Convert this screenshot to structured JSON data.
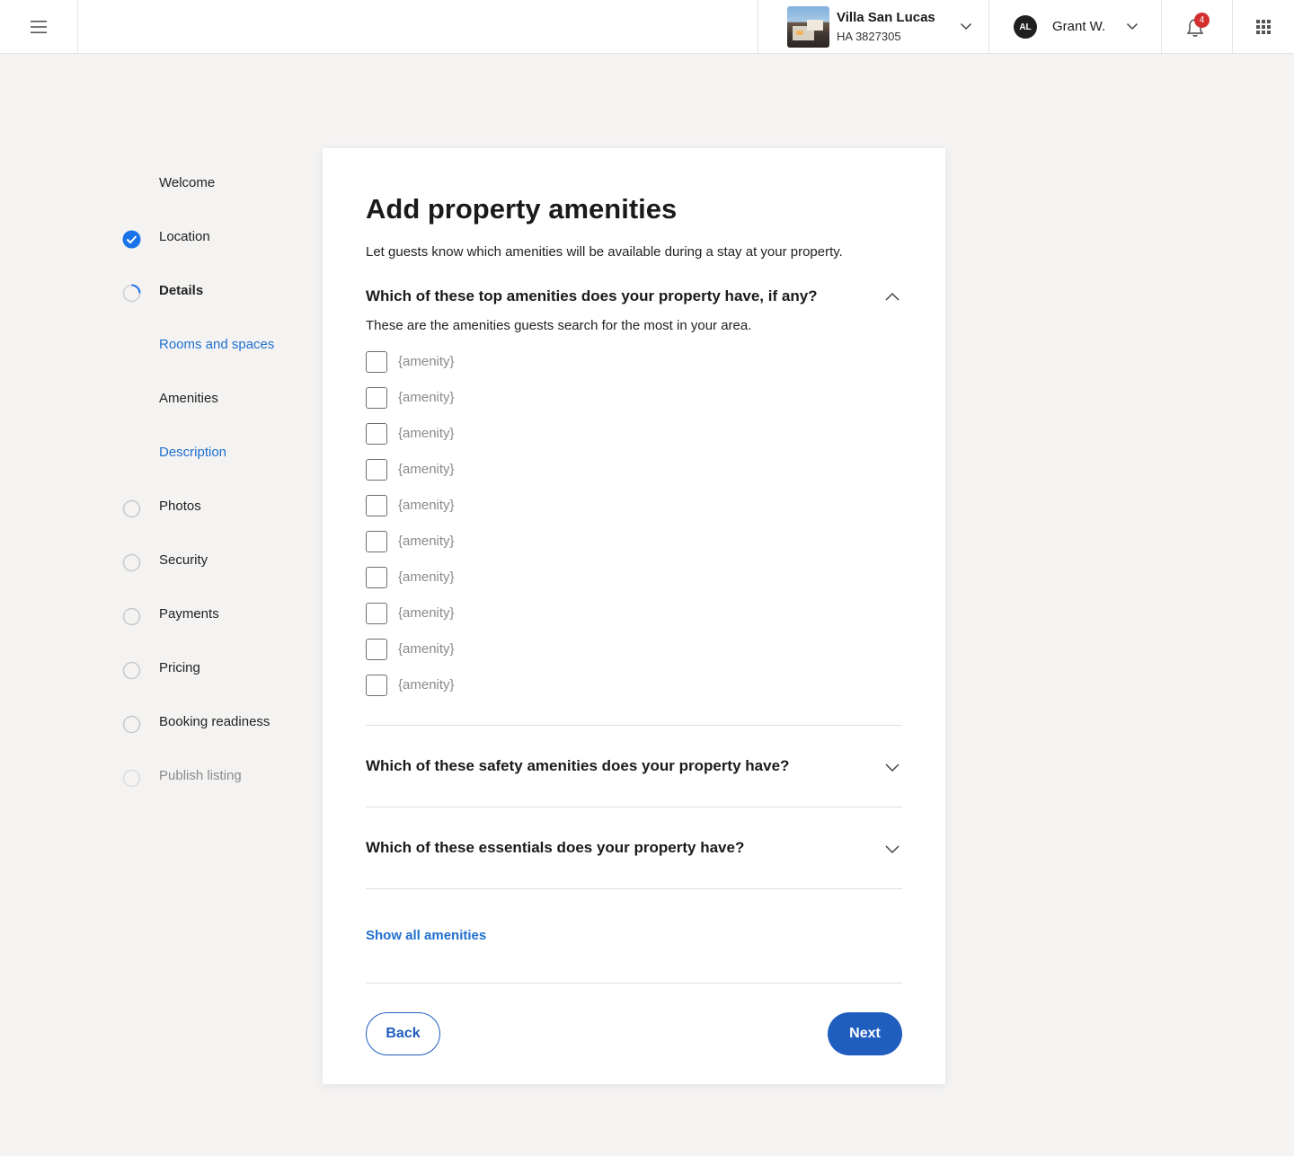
{
  "topbar": {
    "property": {
      "name": "Villa San Lucas",
      "id": "HA 3827305"
    },
    "user": {
      "initials": "AL",
      "name": "Grant W."
    },
    "notifications": {
      "count": "4"
    }
  },
  "steps": [
    {
      "label": "Welcome",
      "status": "none"
    },
    {
      "label": "Location",
      "status": "complete"
    },
    {
      "label": "Details",
      "status": "in-progress"
    },
    {
      "label": "Rooms and spaces",
      "status": "substep-link"
    },
    {
      "label": "Amenities",
      "status": "substep-current"
    },
    {
      "label": "Description",
      "status": "substep-link"
    },
    {
      "label": "Photos",
      "status": "incomplete"
    },
    {
      "label": "Security",
      "status": "incomplete"
    },
    {
      "label": "Payments",
      "status": "incomplete"
    },
    {
      "label": "Pricing",
      "status": "incomplete"
    },
    {
      "label": "Booking readiness",
      "status": "incomplete"
    },
    {
      "label": "Publish listing",
      "status": "disabled"
    }
  ],
  "main": {
    "title": "Add property amenities",
    "subtitle": "Let guests know which amenities will be available during a stay at your property.",
    "sections": [
      {
        "question": "Which of these top amenities does your property have, if any?",
        "description": "These are the amenities guests search for the most in your area.",
        "expanded": true,
        "items": [
          "{amenity}",
          "{amenity}",
          "{amenity}",
          "{amenity}",
          "{amenity}",
          "{amenity}",
          "{amenity}",
          "{amenity}",
          "{amenity}",
          "{amenity}"
        ]
      },
      {
        "question": "Which of these safety amenities does your property have?",
        "expanded": false
      },
      {
        "question": "Which of these essentials does your property have?",
        "expanded": false
      }
    ],
    "show_all": "Show all amenities",
    "back_label": "Back",
    "next_label": "Next"
  },
  "colors": {
    "accent": "#1f5dbf",
    "link": "#1f6fd0",
    "check": "#1a73e8",
    "badge": "#d32f2f",
    "background": "#f4f3f2"
  }
}
